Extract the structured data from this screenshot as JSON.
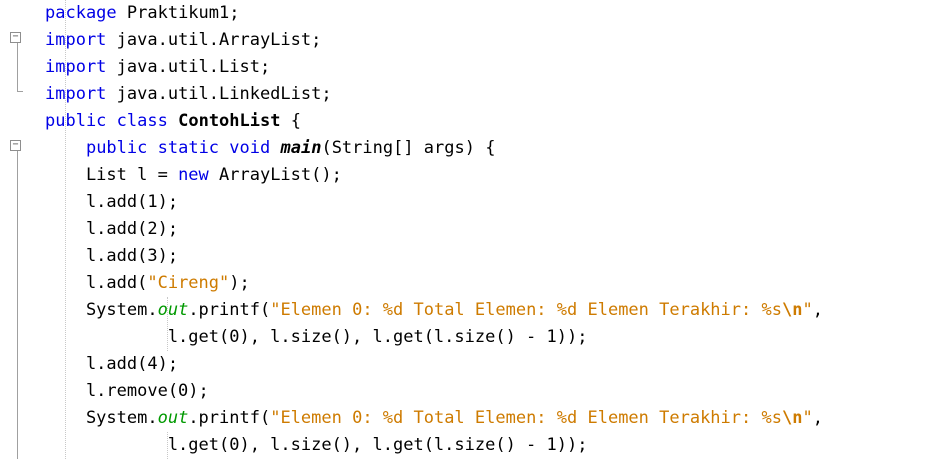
{
  "editor": {
    "fold_symbol": "−",
    "lines": [
      [
        {
          "t": "kw",
          "v": "package"
        },
        {
          "t": "plain",
          "v": " Praktikum1;"
        }
      ],
      [
        {
          "t": "kw",
          "v": "import"
        },
        {
          "t": "plain",
          "v": " java.util.ArrayList;"
        }
      ],
      [
        {
          "t": "kw",
          "v": "import"
        },
        {
          "t": "plain",
          "v": " java.util.List;"
        }
      ],
      [
        {
          "t": "kw",
          "v": "import"
        },
        {
          "t": "plain",
          "v": " java.util.LinkedList;"
        }
      ],
      [
        {
          "t": "kw",
          "v": "public"
        },
        {
          "t": "plain",
          "v": " "
        },
        {
          "t": "kw",
          "v": "class"
        },
        {
          "t": "plain",
          "v": " "
        },
        {
          "t": "cls",
          "v": "ContohList"
        },
        {
          "t": "plain",
          "v": " {"
        }
      ],
      [
        {
          "t": "plain",
          "v": "    "
        },
        {
          "t": "kw",
          "v": "public"
        },
        {
          "t": "plain",
          "v": " "
        },
        {
          "t": "kw",
          "v": "static"
        },
        {
          "t": "plain",
          "v": " "
        },
        {
          "t": "kw",
          "v": "void"
        },
        {
          "t": "plain",
          "v": " "
        },
        {
          "t": "mtd",
          "v": "main"
        },
        {
          "t": "plain",
          "v": "(String[] args) {"
        }
      ],
      [
        {
          "t": "plain",
          "v": "    List l = "
        },
        {
          "t": "kw",
          "v": "new"
        },
        {
          "t": "plain",
          "v": " ArrayList();"
        }
      ],
      [
        {
          "t": "plain",
          "v": "    l.add(1);"
        }
      ],
      [
        {
          "t": "plain",
          "v": "    l.add(2);"
        }
      ],
      [
        {
          "t": "plain",
          "v": "    l.add(3);"
        }
      ],
      [
        {
          "t": "plain",
          "v": "    l.add("
        },
        {
          "t": "str",
          "v": "\"Cireng\""
        },
        {
          "t": "plain",
          "v": ");"
        }
      ],
      [
        {
          "t": "plain",
          "v": "    System."
        },
        {
          "t": "fld",
          "v": "out"
        },
        {
          "t": "plain",
          "v": ".printf("
        },
        {
          "t": "str",
          "v": "\"Elemen 0: %d Total Elemen: %d Elemen Terakhir: %s"
        },
        {
          "t": "esc",
          "v": "\\n"
        },
        {
          "t": "str",
          "v": "\""
        },
        {
          "t": "plain",
          "v": ","
        }
      ],
      [
        {
          "t": "plain",
          "v": "            l.get(0), l.size(), l.get(l.size() - 1));"
        }
      ],
      [
        {
          "t": "plain",
          "v": "    l.add(4);"
        }
      ],
      [
        {
          "t": "plain",
          "v": "    l.remove(0);"
        }
      ],
      [
        {
          "t": "plain",
          "v": "    System."
        },
        {
          "t": "fld",
          "v": "out"
        },
        {
          "t": "plain",
          "v": ".printf("
        },
        {
          "t": "str",
          "v": "\"Elemen 0: %d Total Elemen: %d Elemen Terakhir: %s"
        },
        {
          "t": "esc",
          "v": "\\n"
        },
        {
          "t": "str",
          "v": "\""
        },
        {
          "t": "plain",
          "v": ","
        }
      ],
      [
        {
          "t": "plain",
          "v": "            l.get(0), l.size(), l.get(l.size() - 1));"
        }
      ]
    ]
  }
}
